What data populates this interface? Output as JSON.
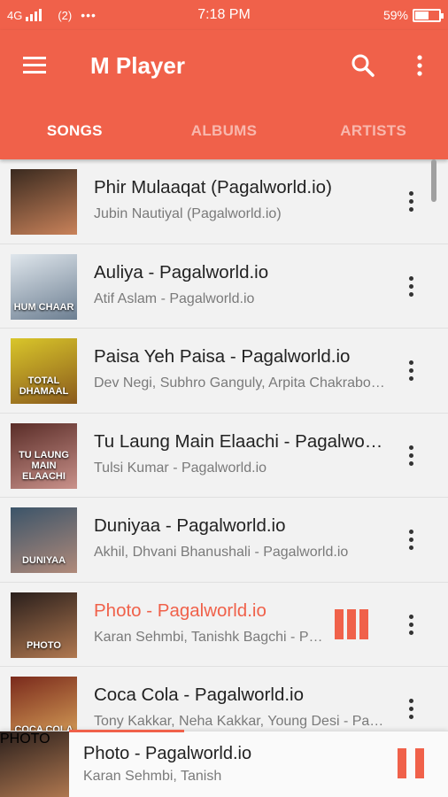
{
  "status_bar": {
    "network": "4G",
    "hotspot": "(2)",
    "more_indicator": "•••",
    "time": "7:18 PM",
    "battery": "59%"
  },
  "app_bar": {
    "title": "M Player",
    "menu_icon": "hamburger-menu-icon",
    "search_icon": "search-icon",
    "overflow_icon": "more-vert-icon"
  },
  "tabs": [
    {
      "label": "SONGS",
      "active": true
    },
    {
      "label": "ALBUMS",
      "active": false
    },
    {
      "label": "ARTISTS",
      "active": false
    }
  ],
  "songs": [
    {
      "title": "Phir Mulaaqat (Pagalworld.io)",
      "artist": "Jubin Nautiyal (Pagalworld.io)",
      "art_caption": "",
      "art_colors": [
        "#3a2a1f",
        "#c9825a"
      ],
      "playing": false
    },
    {
      "title": "Auliya - Pagalworld.io",
      "artist": "Atif Aslam - Pagalworld.io",
      "art_caption": "HUM CHAAR",
      "art_colors": [
        "#dfe6ec",
        "#6d7f92"
      ],
      "playing": false
    },
    {
      "title": "Paisa Yeh Paisa - Pagalworld.io",
      "artist": "Dev Negi, Subhro Ganguly, Arpita Chakraborty",
      "art_caption": "TOTAL DHAMAAL",
      "art_colors": [
        "#d9c62a",
        "#8a5a1c"
      ],
      "playing": false
    },
    {
      "title": "Tu Laung Main Elaachi - Pagalworld.io",
      "artist": "Tulsi Kumar - Pagalworld.io",
      "art_caption": "TU LAUNG MAIN ELAACHI",
      "art_colors": [
        "#5a2d28",
        "#c9918a"
      ],
      "playing": false
    },
    {
      "title": "Duniyaa - Pagalworld.io",
      "artist": "Akhil, Dhvani Bhanushali - Pagalworld.io",
      "art_caption": "DUNIYAA",
      "art_colors": [
        "#3b5469",
        "#b08a7a"
      ],
      "playing": false
    },
    {
      "title": "Photo - Pagalworld.io",
      "artist": "Karan Sehmbi, Tanishk Bagchi - Pagalworld.io",
      "art_caption": "PHOTO",
      "art_colors": [
        "#2a1f1c",
        "#b07850"
      ],
      "playing": true
    },
    {
      "title": "Coca Cola - Pagalworld.io",
      "artist": "Tony Kakkar, Neha Kakkar, Young Desi - Pagalworld.io",
      "art_caption": "COCA COLA",
      "art_colors": [
        "#7a2a1c",
        "#d9a35a"
      ],
      "playing": false
    }
  ],
  "now_playing": {
    "title": "Photo - Pagalworld.io",
    "artist": "Karan Sehmbi, Tanish",
    "art_caption": "PHOTO",
    "art_colors": [
      "#2a1f1c",
      "#b07850"
    ],
    "pause_icon": "pause-icon"
  },
  "colors": {
    "accent": "#f0614a",
    "background": "#f2f2f2"
  }
}
